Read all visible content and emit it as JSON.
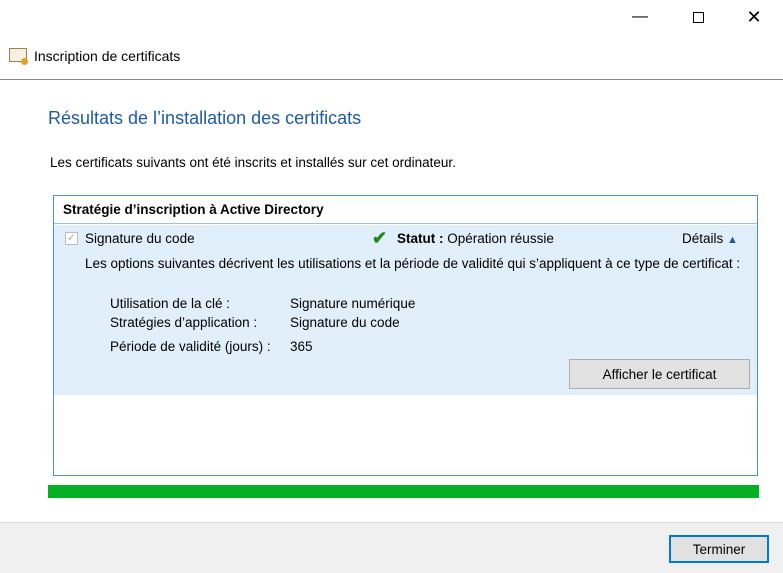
{
  "window": {
    "title": "Inscription de certificats",
    "minimize_icon": "minimize-icon",
    "maximize_icon": "maximize-icon",
    "close_icon": "close-icon"
  },
  "page": {
    "heading": "Résultats de l’installation des certificats",
    "description": "Les certificats suivants ont été inscrits et installés sur cet ordinateur."
  },
  "policy": {
    "header": "Stratégie d’inscription à Active Directory",
    "item": {
      "name": "Signature du code",
      "checked": true,
      "status_label": "Statut :",
      "status_value": "Opération réussie",
      "details_label": "Détails",
      "info": "Les options suivantes décrivent les utilisations et la période de validité qui s’appliquent à ce type de certificat :",
      "props": [
        {
          "label": "Utilisation de la clé :",
          "value": "Signature numérique"
        },
        {
          "label": "Stratégies d’application :",
          "value": "Signature du code"
        },
        {
          "label": "Période de validité (jours) :",
          "value": "365"
        }
      ],
      "view_button": "Afficher le certificat"
    }
  },
  "progress": {
    "percent": 100,
    "color": "#06b025"
  },
  "footer": {
    "finish_button": "Terminer"
  }
}
